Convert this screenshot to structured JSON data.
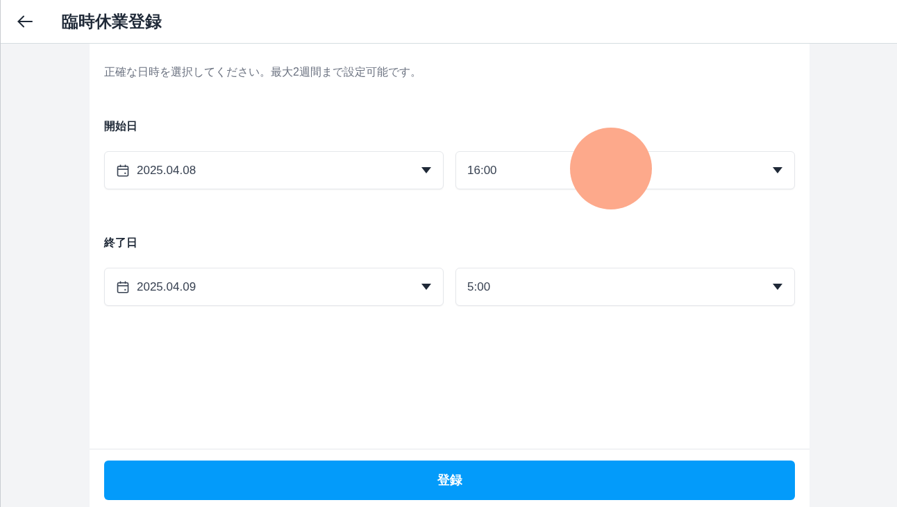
{
  "header": {
    "title": "臨時休業登録"
  },
  "description": "正確な日時を選択してください。最大2週間まで設定可能です。",
  "sections": [
    {
      "label": "開始日",
      "date": "2025.04.08",
      "time": "16:00"
    },
    {
      "label": "終了日",
      "date": "2025.04.09",
      "time": "5:00"
    }
  ],
  "submit_button": "登録"
}
